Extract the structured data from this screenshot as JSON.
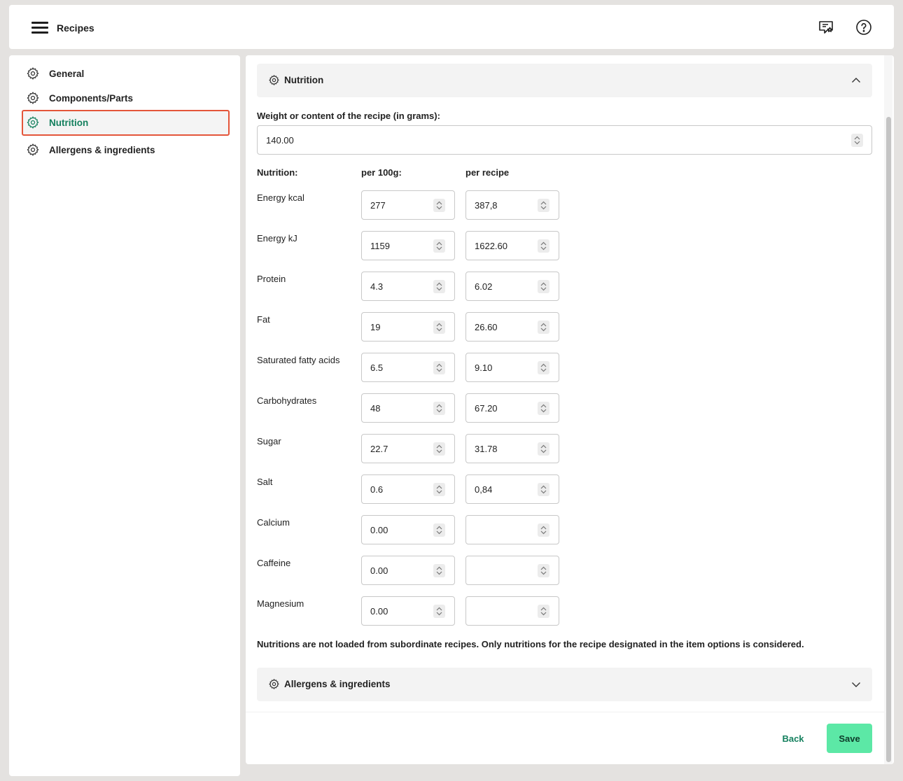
{
  "header": {
    "title": "Recipes"
  },
  "sidebar": {
    "items": [
      {
        "label": "General"
      },
      {
        "label": "Components/Parts"
      },
      {
        "label": "Nutrition"
      },
      {
        "label": "Allergens & ingredients"
      }
    ]
  },
  "nutrition_section": {
    "title": "Nutrition",
    "weight_label": "Weight or content of the recipe (in grams):",
    "weight_value": "140.00",
    "col_nutrition": "Nutrition:",
    "col_per100": "per 100g:",
    "col_recipe": "per recipe",
    "rows": [
      {
        "label": "Energy kcal",
        "per100": "277",
        "recipe": "387,8"
      },
      {
        "label": "Energy kJ",
        "per100": "1159",
        "recipe": "1622.60"
      },
      {
        "label": "Protein",
        "per100": "4.3",
        "recipe": "6.02"
      },
      {
        "label": "Fat",
        "per100": "19",
        "recipe": "26.60"
      },
      {
        "label": "Saturated fatty acids",
        "per100": "6.5",
        "recipe": "9.10"
      },
      {
        "label": "Carbohydrates",
        "per100": "48",
        "recipe": "67.20"
      },
      {
        "label": "Sugar",
        "per100": "22.7",
        "recipe": "31.78"
      },
      {
        "label": "Salt",
        "per100": "0.6",
        "recipe": "0,84"
      },
      {
        "label": "Calcium",
        "per100": "0.00",
        "recipe": ""
      },
      {
        "label": "Caffeine",
        "per100": "0.00",
        "recipe": ""
      },
      {
        "label": "Magnesium",
        "per100": "0.00",
        "recipe": ""
      }
    ],
    "note": "Nutritions are not loaded from subordinate recipes. Only nutritions for the recipe designated in the item options is considered."
  },
  "allergens_section": {
    "title": "Allergens & ingredients"
  },
  "footer": {
    "back_label": "Back",
    "save_label": "Save"
  },
  "colors": {
    "accent": "#14805e",
    "save_button": "#5ce8a6",
    "active_border": "#e4553a"
  }
}
